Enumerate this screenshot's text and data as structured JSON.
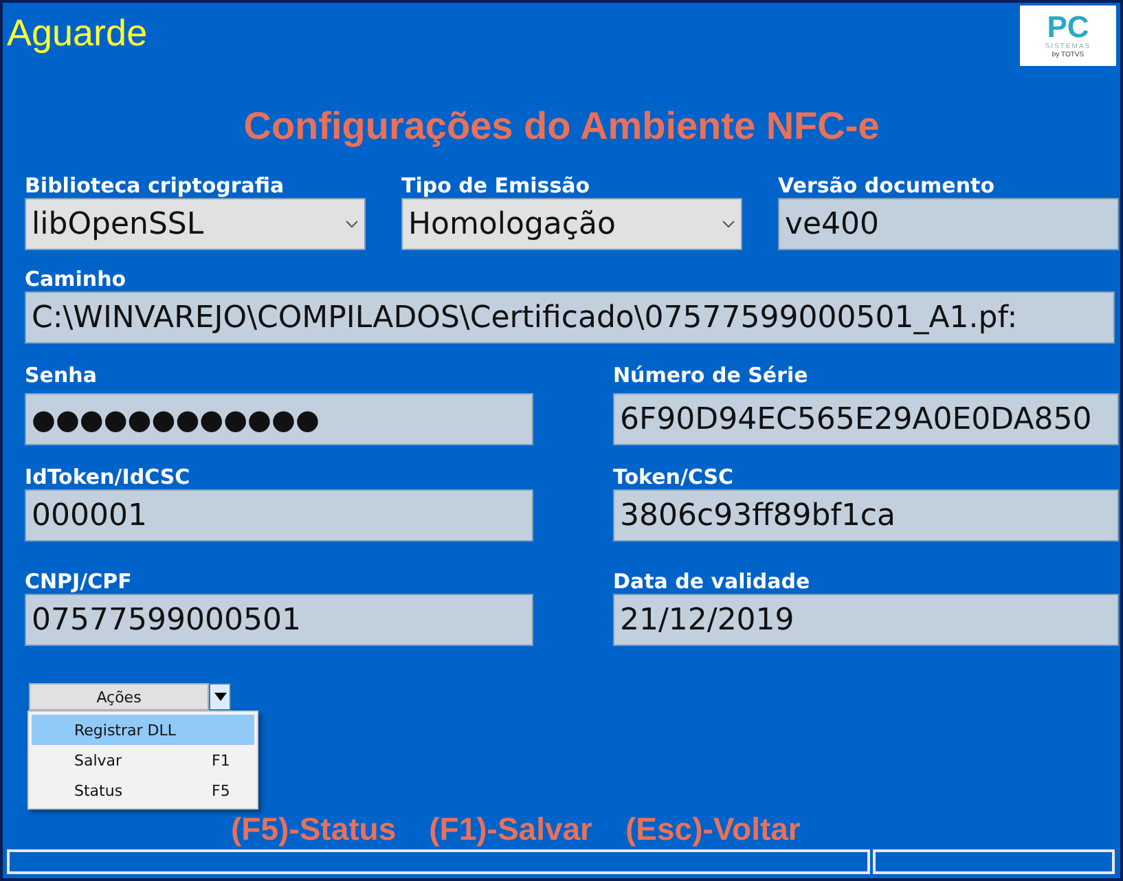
{
  "window": {
    "title": "Aguarde"
  },
  "logo": {
    "mark": "PC",
    "tagline": "SISTEMAS",
    "byline": "by TOTVS"
  },
  "heading": "Configurações do Ambiente NFC-e",
  "form": {
    "rows": [
      [
        {
          "label": "Biblioteca criptografia",
          "value": "libOpenSSL",
          "kind": "select"
        },
        {
          "label": "Tipo de Emissão",
          "value": "Homologação",
          "kind": "select"
        },
        {
          "label": "Versão documento",
          "value": "ve400",
          "kind": "text"
        }
      ],
      [
        {
          "label": "Caminho",
          "value": "C:\\WINVAREJO\\COMPILADOS\\Certificado\\07577599000501_A1.pf:",
          "kind": "text"
        }
      ],
      [
        {
          "label": "Senha",
          "value": "●●●●●●●●●●●●",
          "kind": "password"
        },
        {
          "label": "Número de Série",
          "value": "6F90D94EC565E29A0E0DA850",
          "kind": "text"
        }
      ],
      [
        {
          "label": "IdToken/IdCSC",
          "value": "000001",
          "kind": "text"
        },
        {
          "label": "Token/CSC",
          "value": "3806c93ff89bf1ca",
          "kind": "text"
        }
      ],
      [
        {
          "label": "CNPJ/CPF",
          "value": "07577599000501",
          "kind": "text"
        },
        {
          "label": "Data de validade",
          "value": "21/12/2019",
          "kind": "text"
        }
      ]
    ]
  },
  "actions": {
    "label": "Ações",
    "expanded": true,
    "menu": [
      {
        "label": "Registrar DLL",
        "selected": true
      },
      {
        "label": "Salvar",
        "shortcut": "F1",
        "selected": false
      },
      {
        "label": "Status",
        "shortcut": "F5",
        "selected": false
      }
    ]
  },
  "shortcuts": [
    "(F5)-Status",
    "(F1)-Salvar",
    "(Esc)-Voltar"
  ]
}
